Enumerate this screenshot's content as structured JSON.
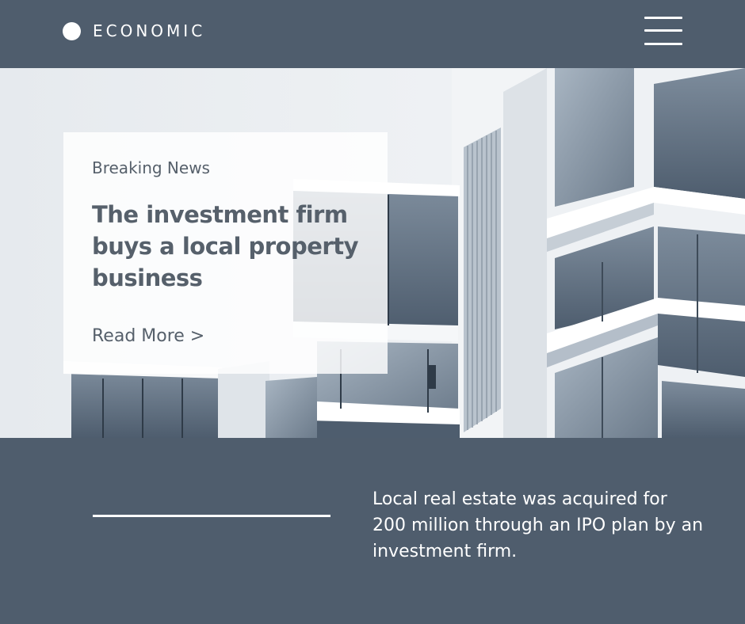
{
  "header": {
    "brand": "ECONOMIC",
    "logo_icon": "circle-logo-icon",
    "menu_icon": "hamburger-menu-icon"
  },
  "hero": {
    "kicker": "Breaking News",
    "headline": "The investment firm buys a local property business",
    "read_more": "Read More >"
  },
  "footer": {
    "summary": "Local real estate was acquired for 200 million through an IPO plan by an investment firm."
  },
  "colors": {
    "background": "#4f5d6d",
    "text_dark": "#56606b",
    "white": "#ffffff"
  }
}
